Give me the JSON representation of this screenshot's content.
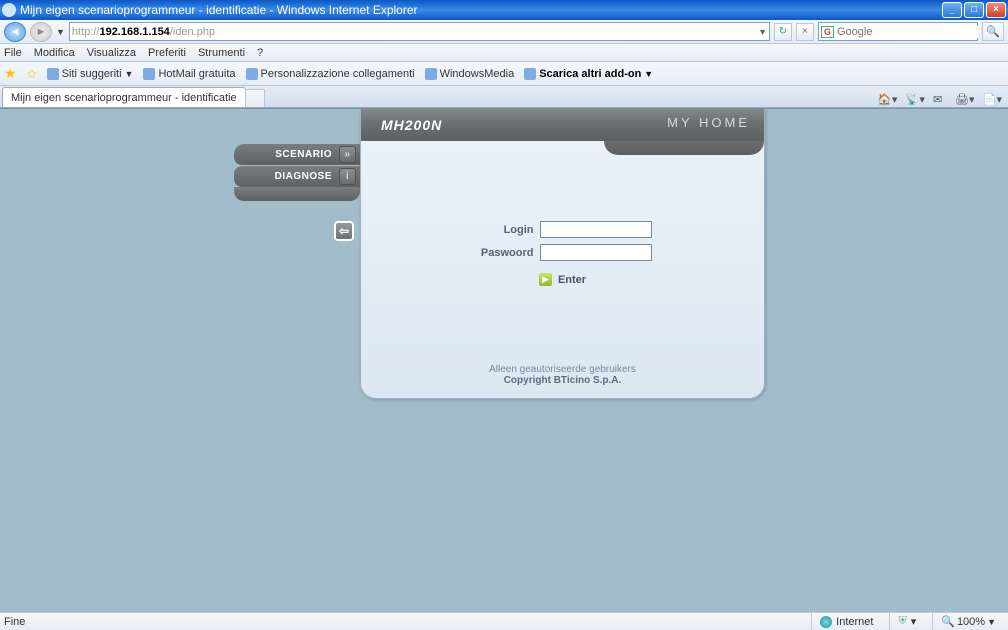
{
  "window": {
    "title": "Mijn eigen scenarioprogrammeur - identificatie - Windows Internet Explorer"
  },
  "url": {
    "prefix": "http://",
    "host": "192.168.1.154",
    "path": "/iden.php"
  },
  "search": {
    "provider_glyph": "G",
    "placeholder": "Google"
  },
  "menu": {
    "file": "File",
    "edit": "Modifica",
    "view": "Visualizza",
    "favorites": "Preferiti",
    "tools": "Strumenti",
    "help": "?"
  },
  "links": {
    "suggested": "Siti suggeriti",
    "hotmail": "HotMail gratuita",
    "personalization": "Personalizzazione collegamenti",
    "windowsmedia": "WindowsMedia",
    "addons": "Scarica altri add-on"
  },
  "tabs": {
    "active": "Mijn eigen scenarioprogrammeur - identificatie"
  },
  "side": {
    "scenario": "SCENARIO",
    "diagnose": "DIAGNOSE"
  },
  "panel": {
    "title": "MH200N",
    "logo": "MY HOME",
    "login_label": "Login",
    "password_label": "Paswoord",
    "enter": "Enter",
    "footer_line1": "Alleen geautoriseerde gebruikers",
    "footer_line2": "Copyright BTicino S.p.A."
  },
  "status": {
    "left": "Fine",
    "zone": "Internet",
    "zoom": "100%"
  }
}
